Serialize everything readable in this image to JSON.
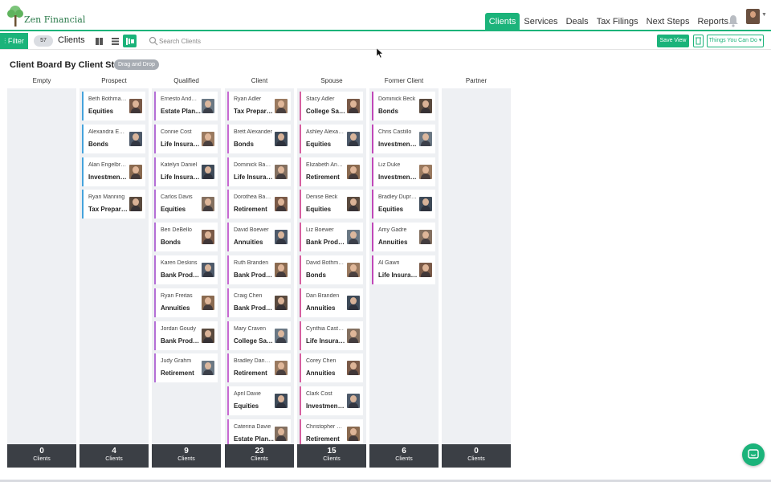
{
  "app": {
    "name": "Zen Financial",
    "nav": [
      "Clients",
      "Services",
      "Deals",
      "Tax Filings",
      "Next Steps",
      "Reports"
    ],
    "active_nav": "Clients"
  },
  "toolbar": {
    "filter_label": "Filter",
    "count": "57",
    "clients_label": "Clients",
    "search_placeholder": "Search Clients",
    "save_view_label": "Save View",
    "things_label": "Things You Can Do",
    "accent_color": "#1bb37a"
  },
  "board": {
    "title": "Client Board By Client Status",
    "badge": "Drag and Drop",
    "columns": [
      {
        "title": "Empty",
        "count": "0",
        "count_label": "Clients",
        "accent": "#9aa0a8",
        "cards": []
      },
      {
        "title": "Prospect",
        "count": "4",
        "count_label": "Clients",
        "accent": "#45a3dc",
        "cards": [
          {
            "name": "Beth Bothmann",
            "product": "Equities"
          },
          {
            "name": "Alexandra Em...",
            "product": "Bonds"
          },
          {
            "name": "Alan Engelbre...",
            "product": "Investment ..."
          },
          {
            "name": "Ryan Manning",
            "product": "Tax Prepara..."
          }
        ]
      },
      {
        "title": "Qualified",
        "count": "9",
        "count_label": "Clients",
        "accent": "#b46fd6",
        "cards": [
          {
            "name": "Ernesto Andol...",
            "product": "Estate Plan..."
          },
          {
            "name": "Connie Cost",
            "product": "Life Insuran..."
          },
          {
            "name": "Katelyn Daniel",
            "product": "Life Insuran..."
          },
          {
            "name": "Carlos Davis",
            "product": "Equities"
          },
          {
            "name": "Ben DeBello",
            "product": "Bonds"
          },
          {
            "name": "Karen Deskins",
            "product": "Bank Produ..."
          },
          {
            "name": "Ryan Freitas",
            "product": "Annuities"
          },
          {
            "name": "Jordan Goudy",
            "product": "Bank Produ..."
          },
          {
            "name": "Judy Grahm",
            "product": "Retirement"
          }
        ]
      },
      {
        "title": "Client",
        "count": "23",
        "count_label": "Clients",
        "accent": "#c86ad2",
        "cards": [
          {
            "name": "Ryan Adler",
            "product": "Tax Prepara..."
          },
          {
            "name": "Brett Alexander",
            "product": "Bonds"
          },
          {
            "name": "Dominick Bauer",
            "product": "Life Insuran..."
          },
          {
            "name": "Dorothea Bauer",
            "product": "Retirement"
          },
          {
            "name": "David Boewer",
            "product": "Annuities"
          },
          {
            "name": "Ruth Branden",
            "product": "Bank Produ..."
          },
          {
            "name": "Craig Chen",
            "product": "Bank Produ..."
          },
          {
            "name": "Mary Craven",
            "product": "College Savi..."
          },
          {
            "name": "Bradley Dann...",
            "product": "Retirement"
          },
          {
            "name": "April Davie",
            "product": "Equities"
          },
          {
            "name": "Caterina Davie",
            "product": "Estate Plan..."
          }
        ]
      },
      {
        "title": "Spouse",
        "count": "15",
        "count_label": "Clients",
        "accent": "#d65fa0",
        "cards": [
          {
            "name": "Stacy Adler",
            "product": "College Savi..."
          },
          {
            "name": "Ashley Alexan...",
            "product": "Equities"
          },
          {
            "name": "Elizabeth And...",
            "product": "Retirement"
          },
          {
            "name": "Denise Beck",
            "product": "Equities"
          },
          {
            "name": "Liz Boewer",
            "product": "Bank Produ..."
          },
          {
            "name": "David Bothma...",
            "product": "Bonds"
          },
          {
            "name": "Dan Branden",
            "product": "Annuities"
          },
          {
            "name": "Cynthia Castillo",
            "product": "Life Insuran..."
          },
          {
            "name": "Corey Chen",
            "product": "Annuities"
          },
          {
            "name": "Clark Cost",
            "product": "Investment ..."
          },
          {
            "name": "Christopher C...",
            "product": "Retirement"
          }
        ]
      },
      {
        "title": "Former Client",
        "count": "6",
        "count_label": "Clients",
        "accent": "#c048b8",
        "cards": [
          {
            "name": "Dominick Beck",
            "product": "Bonds"
          },
          {
            "name": "Chris Castillo",
            "product": "Investment ..."
          },
          {
            "name": "Liz Duke",
            "product": "Investment ..."
          },
          {
            "name": "Bradley Dupree",
            "product": "Equities"
          },
          {
            "name": "Amy Gadre",
            "product": "Annuities"
          },
          {
            "name": "Al Gawri",
            "product": "Life Insuran..."
          }
        ]
      },
      {
        "title": "Partner",
        "count": "0",
        "count_label": "Clients",
        "accent": "#9aa0a8",
        "cards": []
      }
    ]
  }
}
